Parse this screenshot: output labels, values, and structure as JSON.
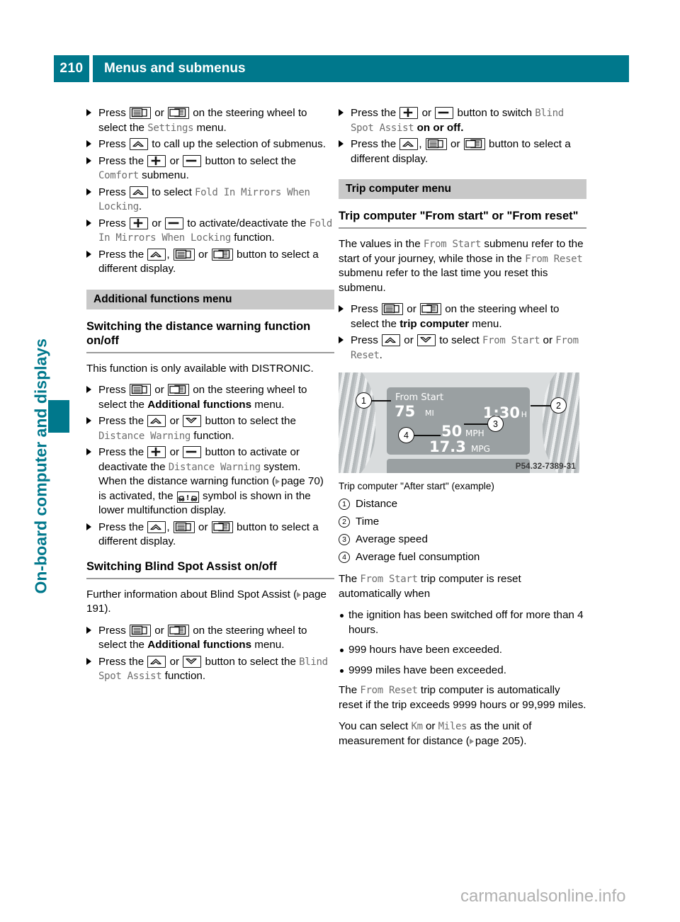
{
  "header": {
    "page_number": "210",
    "title": "Menus and submenus"
  },
  "side_tab": {
    "label": "On-board computer and displays"
  },
  "watermark": "carmanualsonline.info",
  "left_column": {
    "steps": [
      {
        "parts": [
          {
            "t": "txt",
            "v": "Press "
          },
          {
            "t": "key",
            "v": "mfd-left-icon"
          },
          {
            "t": "txt",
            "v": " or "
          },
          {
            "t": "key",
            "v": "mfd-right-icon"
          },
          {
            "t": "txt",
            "v": " on the steering wheel to select the "
          },
          {
            "t": "mono",
            "v": "Settings"
          },
          {
            "t": "txt",
            "v": " menu."
          }
        ]
      },
      {
        "parts": [
          {
            "t": "txt",
            "v": "Press "
          },
          {
            "t": "key",
            "v": "up-arrow-icon"
          },
          {
            "t": "txt",
            "v": " to call up the selection of submenus."
          }
        ]
      },
      {
        "parts": [
          {
            "t": "txt",
            "v": "Press the "
          },
          {
            "t": "key",
            "v": "plus-icon"
          },
          {
            "t": "txt",
            "v": " or "
          },
          {
            "t": "key",
            "v": "minus-icon"
          },
          {
            "t": "txt",
            "v": " button to select the "
          },
          {
            "t": "mono",
            "v": "Comfort"
          },
          {
            "t": "txt",
            "v": " submenu."
          }
        ]
      },
      {
        "parts": [
          {
            "t": "txt",
            "v": "Press "
          },
          {
            "t": "key",
            "v": "up-arrow-icon"
          },
          {
            "t": "txt",
            "v": " to select "
          },
          {
            "t": "mono",
            "v": "Fold In Mirrors When Locking"
          },
          {
            "t": "txt",
            "v": "."
          }
        ]
      },
      {
        "parts": [
          {
            "t": "txt",
            "v": "Press "
          },
          {
            "t": "key",
            "v": "plus-icon"
          },
          {
            "t": "txt",
            "v": " or "
          },
          {
            "t": "key",
            "v": "minus-icon"
          },
          {
            "t": "txt",
            "v": " to activate/deactivate the "
          },
          {
            "t": "mono",
            "v": "Fold In Mirrors When Locking"
          },
          {
            "t": "txt",
            "v": " function."
          }
        ]
      },
      {
        "parts": [
          {
            "t": "txt",
            "v": "Press the "
          },
          {
            "t": "key",
            "v": "up-arrow-icon"
          },
          {
            "t": "txt",
            "v": ", "
          },
          {
            "t": "key",
            "v": "mfd-left-icon"
          },
          {
            "t": "txt",
            "v": " or "
          },
          {
            "t": "key",
            "v": "mfd-right-icon"
          },
          {
            "t": "txt",
            "v": " button to select a different display."
          }
        ]
      }
    ],
    "section_bar": "Additional functions menu",
    "subhead_1": "Switching the distance warning function on/off",
    "intro_1": "This function is only available with DISTRONIC.",
    "steps_2": [
      {
        "parts": [
          {
            "t": "txt",
            "v": "Press "
          },
          {
            "t": "key",
            "v": "mfd-left-icon"
          },
          {
            "t": "txt",
            "v": " or "
          },
          {
            "t": "key",
            "v": "mfd-right-icon"
          },
          {
            "t": "txt",
            "v": " on the steering wheel to select the "
          },
          {
            "t": "b",
            "v": "Additional functions"
          },
          {
            "t": "txt",
            "v": " menu."
          }
        ]
      },
      {
        "parts": [
          {
            "t": "txt",
            "v": "Press the "
          },
          {
            "t": "key",
            "v": "up-arrow-icon"
          },
          {
            "t": "txt",
            "v": " or "
          },
          {
            "t": "key",
            "v": "down-arrow-icon"
          },
          {
            "t": "txt",
            "v": " button to select the "
          },
          {
            "t": "mono",
            "v": "Distance Warning"
          },
          {
            "t": "txt",
            "v": " function."
          }
        ]
      },
      {
        "parts": [
          {
            "t": "txt",
            "v": "Press the "
          },
          {
            "t": "key",
            "v": "plus-icon"
          },
          {
            "t": "txt",
            "v": " or "
          },
          {
            "t": "key",
            "v": "minus-icon"
          },
          {
            "t": "txt",
            "v": " button to activate or deactivate the "
          },
          {
            "t": "mono",
            "v": "Distance Warning"
          },
          {
            "t": "txt",
            "v": " system."
          },
          {
            "t": "br",
            "v": ""
          },
          {
            "t": "txt",
            "v": "When the distance warning function ("
          },
          {
            "t": "ref",
            "v": "page 70"
          },
          {
            "t": "txt",
            "v": ") is activated, the "
          },
          {
            "t": "sym",
            "v": "distance-warning-symbol"
          },
          {
            "t": "txt",
            "v": " symbol is shown in the lower multifunction display."
          }
        ]
      },
      {
        "parts": [
          {
            "t": "txt",
            "v": "Press the "
          },
          {
            "t": "key",
            "v": "up-arrow-icon"
          },
          {
            "t": "txt",
            "v": ", "
          },
          {
            "t": "key",
            "v": "mfd-left-icon"
          },
          {
            "t": "txt",
            "v": " or "
          },
          {
            "t": "key",
            "v": "mfd-right-icon"
          },
          {
            "t": "txt",
            "v": " button to select a different display."
          }
        ]
      }
    ],
    "subhead_2": "Switching Blind Spot Assist on/off",
    "intro_2_pre": "Further information about Blind Spot Assist (",
    "intro_2_ref": "page 191",
    "intro_2_post": ").",
    "steps_3": [
      {
        "parts": [
          {
            "t": "txt",
            "v": "Press "
          },
          {
            "t": "key",
            "v": "mfd-left-icon"
          },
          {
            "t": "txt",
            "v": " or "
          },
          {
            "t": "key",
            "v": "mfd-right-icon"
          },
          {
            "t": "txt",
            "v": " on the steering wheel to select the "
          },
          {
            "t": "b",
            "v": "Additional functions"
          },
          {
            "t": "txt",
            "v": " menu."
          }
        ]
      },
      {
        "parts": [
          {
            "t": "txt",
            "v": "Press the "
          },
          {
            "t": "key",
            "v": "up-arrow-icon"
          },
          {
            "t": "txt",
            "v": " or "
          },
          {
            "t": "key",
            "v": "down-arrow-icon"
          },
          {
            "t": "txt",
            "v": " button to select the "
          },
          {
            "t": "mono",
            "v": "Blind Spot Assist"
          },
          {
            "t": "txt",
            "v": " function."
          }
        ]
      }
    ]
  },
  "right_column": {
    "steps_1": [
      {
        "parts": [
          {
            "t": "txt",
            "v": "Press the "
          },
          {
            "t": "key",
            "v": "plus-icon"
          },
          {
            "t": "txt",
            "v": " or "
          },
          {
            "t": "key",
            "v": "minus-icon"
          },
          {
            "t": "txt",
            "v": " button to switch "
          },
          {
            "t": "mono",
            "v": "Blind Spot Assist"
          },
          {
            "t": "b",
            "v": " on or off."
          }
        ]
      },
      {
        "parts": [
          {
            "t": "txt",
            "v": "Press the "
          },
          {
            "t": "key",
            "v": "up-arrow-icon"
          },
          {
            "t": "txt",
            "v": ", "
          },
          {
            "t": "key",
            "v": "mfd-left-icon"
          },
          {
            "t": "txt",
            "v": " or "
          },
          {
            "t": "key",
            "v": "mfd-right-icon"
          },
          {
            "t": "txt",
            "v": " button to select a different display."
          }
        ]
      }
    ],
    "section_bar": "Trip computer menu",
    "subhead_1": "Trip computer \"From start\" or \"From reset\"",
    "intro_parts": [
      {
        "t": "txt",
        "v": "The values in the "
      },
      {
        "t": "mono",
        "v": "From Start"
      },
      {
        "t": "txt",
        "v": " submenu refer to the start of your journey, while those in the "
      },
      {
        "t": "mono",
        "v": "From Reset"
      },
      {
        "t": "txt",
        "v": " submenu refer to the last time you reset this submenu."
      }
    ],
    "steps_2": [
      {
        "parts": [
          {
            "t": "txt",
            "v": "Press "
          },
          {
            "t": "key",
            "v": "mfd-left-icon"
          },
          {
            "t": "txt",
            "v": " or "
          },
          {
            "t": "key",
            "v": "mfd-right-icon"
          },
          {
            "t": "txt",
            "v": " on the steering wheel to select the "
          },
          {
            "t": "b",
            "v": "trip computer"
          },
          {
            "t": "txt",
            "v": " menu."
          }
        ]
      },
      {
        "parts": [
          {
            "t": "txt",
            "v": "Press "
          },
          {
            "t": "key",
            "v": "up-arrow-icon"
          },
          {
            "t": "txt",
            "v": " or "
          },
          {
            "t": "key",
            "v": "down-arrow-icon"
          },
          {
            "t": "txt",
            "v": " to select "
          },
          {
            "t": "mono",
            "v": "From Start"
          },
          {
            "t": "txt",
            "v": " or "
          },
          {
            "t": "mono",
            "v": "From Reset"
          },
          {
            "t": "txt",
            "v": "."
          }
        ]
      }
    ],
    "figure": {
      "display_title": "From Start",
      "distance_value": "75",
      "distance_unit": "MI",
      "time_value": "1:30",
      "time_unit": "H",
      "speed_value": "50",
      "speed_unit": "MPH",
      "fuel_value": "17.3",
      "fuel_unit": "MPG",
      "callouts": [
        "1",
        "2",
        "3",
        "4"
      ],
      "part_code": "P54.32-7389-31"
    },
    "fig_caption": "Trip computer \"After start\" (example)",
    "legend": [
      {
        "num": "1",
        "label": "Distance"
      },
      {
        "num": "2",
        "label": "Time"
      },
      {
        "num": "3",
        "label": "Average speed"
      },
      {
        "num": "4",
        "label": "Average fuel consumption"
      }
    ],
    "reset_intro_parts": [
      {
        "t": "txt",
        "v": "The "
      },
      {
        "t": "mono",
        "v": "From Start"
      },
      {
        "t": "txt",
        "v": " trip computer is reset automatically when"
      }
    ],
    "reset_bullets": [
      "the ignition has been switched off for more than 4 hours.",
      "999 hours have been exceeded.",
      "9999 miles have been exceeded."
    ],
    "reset_para_parts": [
      {
        "t": "txt",
        "v": "The "
      },
      {
        "t": "mono",
        "v": "From Reset"
      },
      {
        "t": "txt",
        "v": " trip computer is automatically reset if the trip exceeds 9999 hours or 99,999 miles."
      }
    ],
    "unit_para_parts": [
      {
        "t": "txt",
        "v": "You can select "
      },
      {
        "t": "mono",
        "v": "Km"
      },
      {
        "t": "txt",
        "v": " or "
      },
      {
        "t": "mono",
        "v": "Miles"
      },
      {
        "t": "txt",
        "v": " as the unit of measurement for distance ("
      },
      {
        "t": "ref",
        "v": "page 205"
      },
      {
        "t": "txt",
        "v": ")."
      }
    ]
  },
  "colors": {
    "brand": "#00788c",
    "section_bar": "#c8c8c8",
    "mono_text": "#6d6d6d"
  }
}
